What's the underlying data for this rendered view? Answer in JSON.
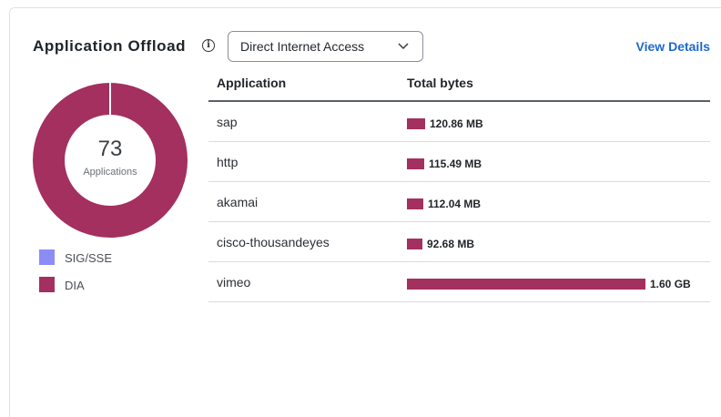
{
  "widget": {
    "title": "Application Offload",
    "info_icon": "info-circle-icon",
    "dropdown": {
      "selected": "Direct Internet Access",
      "icon": "chevron-down-icon"
    },
    "view_details": "View Details"
  },
  "donut": {
    "value": "73",
    "label": "Applications",
    "segments": [
      {
        "name": "SIG/SSE",
        "share": 0.0,
        "color": "#8c8cf5"
      },
      {
        "name": "DIA",
        "share": 1.0,
        "color": "#a3305f"
      }
    ]
  },
  "legend": [
    {
      "label": "SIG/SSE",
      "color": "#8c8cf5"
    },
    {
      "label": "DIA",
      "color": "#a3305f"
    }
  ],
  "table": {
    "headers": {
      "application": "Application",
      "total_bytes": "Total bytes"
    },
    "bar_color": "#a3305f",
    "rows": [
      {
        "app": "sap",
        "bytes_label": "120.86 MB",
        "bytes_mb": 120.86
      },
      {
        "app": "http",
        "bytes_label": "115.49 MB",
        "bytes_mb": 115.49
      },
      {
        "app": "akamai",
        "bytes_label": "112.04 MB",
        "bytes_mb": 112.04
      },
      {
        "app": "cisco-thousandeyes",
        "bytes_label": "92.68 MB",
        "bytes_mb": 92.68
      },
      {
        "app": "vimeo",
        "bytes_label": "1.60 GB",
        "bytes_mb": 1600
      }
    ]
  }
}
